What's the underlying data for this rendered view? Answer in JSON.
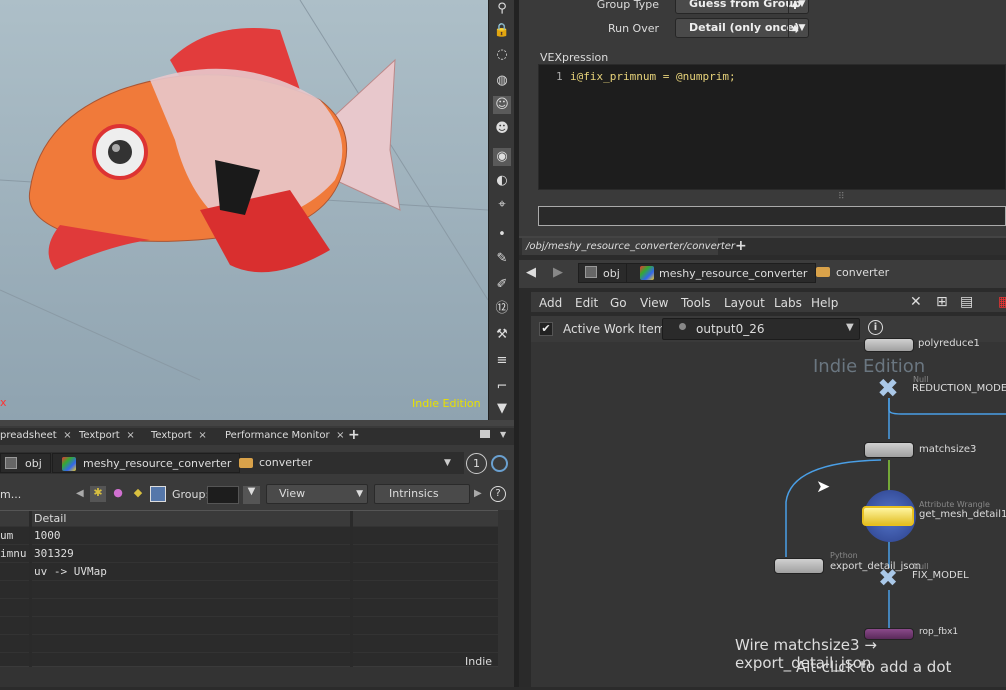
{
  "viewport": {
    "indie_label": "Indie Edition",
    "axis_label": "x"
  },
  "params": {
    "group_type_label": "Group Type",
    "group_type_value": "Guess from Group",
    "run_over_label": "Run Over",
    "run_over_value": "Detail (only once)",
    "vex_label": "VEXpression",
    "vex_line_no": "1",
    "vex_code": "i@fix_primnum = @numprim;"
  },
  "net": {
    "tab_title": "/obj/meshy_resource_converter/converter",
    "add_tab": "+",
    "crumbs": [
      "obj",
      "meshy_resource_converter",
      "converter"
    ],
    "menus": [
      "Add",
      "Edit",
      "Go",
      "View",
      "Tools",
      "Layout",
      "Labs",
      "Help"
    ],
    "active_work_item_label": "Active Work Item:",
    "active_work_item_value": "output0_26",
    "indie_label": "Indie Edition",
    "nodes": {
      "polyreduce": "polyreduce1",
      "reduction_type": "Null",
      "reduction": "REDUCTION_MODEL",
      "matchsize": "matchsize3",
      "wrangle_type": "Attribute Wrangle",
      "wrangle": "get_mesh_detail1",
      "python_type": "Python",
      "export": "export_detail_json",
      "fix_type": "Null",
      "fix": "FIX_MODEL",
      "rop": "rop_fbx1"
    },
    "hint_line1": "Wire matchsize3 → export_detail_json",
    "hint_line2": "Alt-click to add a dot"
  },
  "lower": {
    "tabs": [
      "preadsheet",
      "Textport",
      "Textport",
      "Performance Monitor"
    ],
    "add_tab": "+",
    "crumbs": [
      "obj",
      "meshy_resource_converter",
      "converter"
    ],
    "badge": "1",
    "toolbar_label": "m...",
    "group_label": "Group:",
    "view_value": "View",
    "intrinsics_value": "Intrinsics",
    "column_header": "Detail",
    "rows": [
      {
        "name": "um",
        "value": "1000"
      },
      {
        "name": "imnu",
        "value": "301329"
      },
      {
        "name": "",
        "value": "uv -> UVMap"
      }
    ],
    "indie_label": "Indie"
  }
}
